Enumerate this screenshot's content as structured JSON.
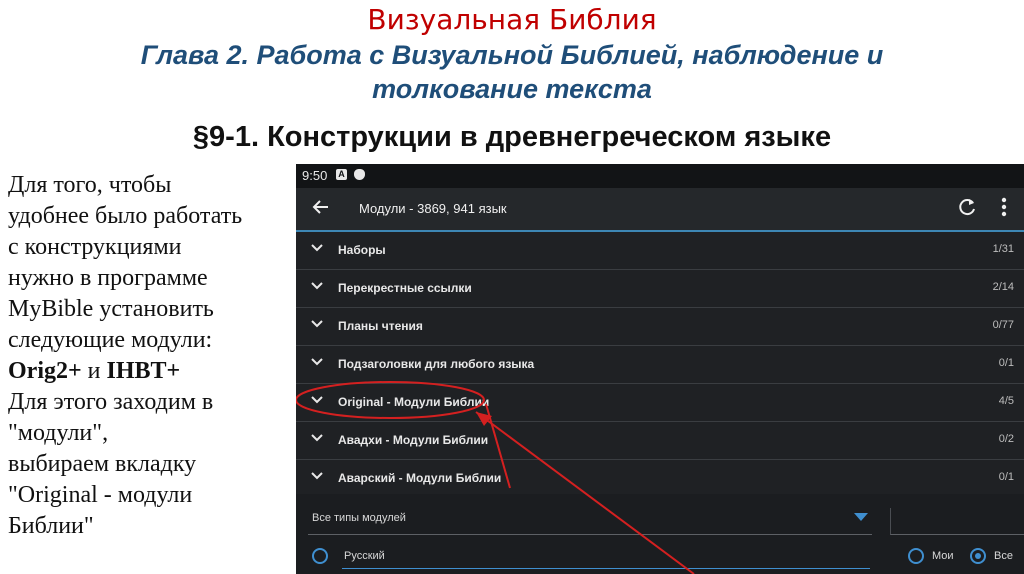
{
  "slide": {
    "title": "Визуальная Библия",
    "subtitle_line1": "Глава 2. Работа с Визуальной Библией, наблюдение и",
    "subtitle_line2": "толкование текста",
    "section": "§9-1. Конструкции в древнегреческом языке"
  },
  "body": {
    "line1": "Для того, чтобы",
    "line2": "удобнее было работать",
    "line3": "с конструкциями",
    "line4": "нужно в программе",
    "line5": "MyBible установить",
    "line6": "следующие модули:",
    "module1": "Orig2+",
    "conj": " и ",
    "module2": "IHBT+",
    "line8": "Для этого заходим в",
    "line9": "\"модули\",",
    "line10": "выбираем вкладку",
    "line11": "\"Original - модули",
    "line12": "Библии\""
  },
  "phone": {
    "status": {
      "time": "9:50",
      "icon1": "A",
      "icon2": "shield-icon"
    },
    "toolbar": {
      "back_icon": "arrow-left-icon",
      "title": "Модули - 3869, 941 язык",
      "refresh_icon": "refresh-icon",
      "more_icon": "more-vert-icon"
    },
    "list": [
      {
        "name": "Наборы",
        "count": "1/31"
      },
      {
        "name": "Перекрестные ссылки",
        "count": "2/14"
      },
      {
        "name": "Планы чтения",
        "count": "0/77"
      },
      {
        "name": "Подзаголовки для любого языка",
        "count": "0/1"
      },
      {
        "name": "Original - Модули Библии",
        "count": "4/5"
      },
      {
        "name": "Авадхи - Модули Библии",
        "count": "0/2"
      },
      {
        "name": "Аварский - Модули Библии",
        "count": "0/1"
      }
    ],
    "bottom": {
      "module_type": "Все типы модулей",
      "language": "Русский",
      "radio_mine": "Мои",
      "radio_all": "Все"
    }
  },
  "colors": {
    "title": "#c00000",
    "subtitle": "#1f4e79",
    "accent": "#3f8fd0",
    "annotation": "#d42020"
  }
}
